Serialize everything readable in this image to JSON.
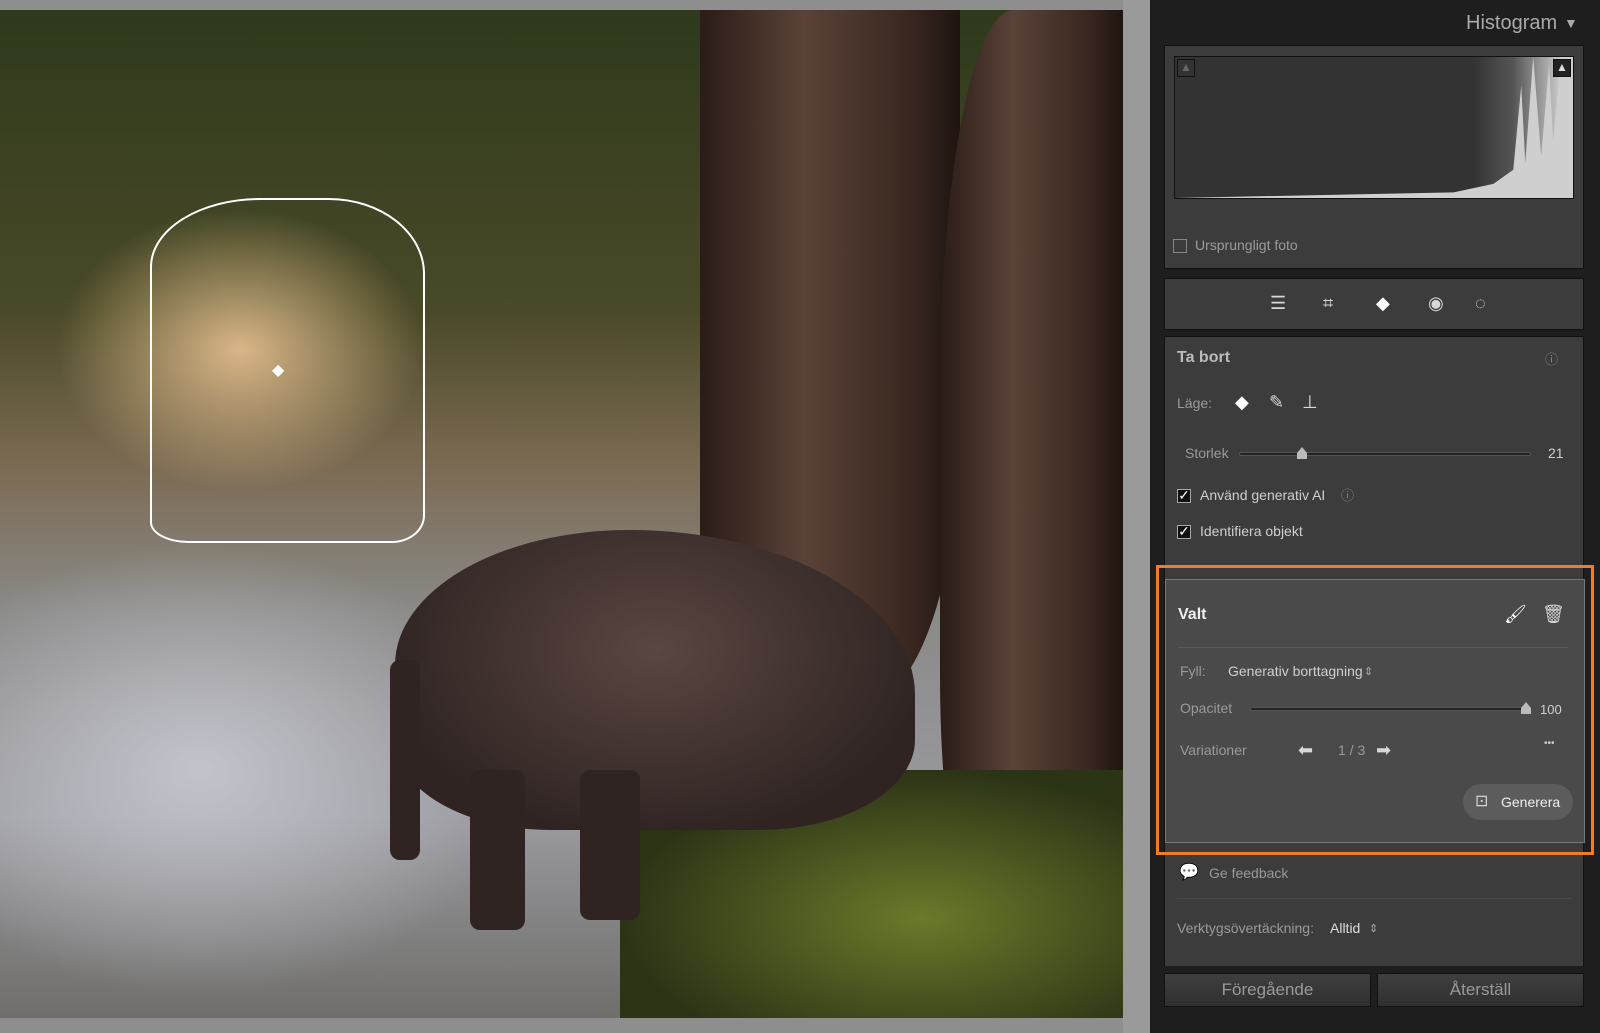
{
  "histogram": {
    "title": "Histogram",
    "original_photo_label": "Ursprungligt foto",
    "original_photo_checked": false
  },
  "toolbar": {
    "tools": [
      "edit-sliders-icon",
      "crop-icon",
      "remove-eraser-icon",
      "red-eye-icon",
      "masking-icon"
    ],
    "active": "remove-eraser-icon"
  },
  "remove": {
    "title": "Ta bort",
    "mode_label": "Läge:",
    "modes": [
      "eraser-icon",
      "heal-icon",
      "clone-stamp-icon"
    ],
    "size_label": "Storlek",
    "size_value": "21",
    "size": 21,
    "use_gen_ai_label": "Använd generativ AI",
    "use_gen_ai_checked": true,
    "detect_objects_label": "Identifiera objekt",
    "detect_objects_checked": true
  },
  "selected": {
    "title": "Valt",
    "fill_label": "Fyll:",
    "fill_value": "Generativ borttagning",
    "opacity_label": "Opacitet",
    "opacity_value": "100",
    "opacity": 100,
    "variations_label": "Variationer",
    "variations_value": "1 / 3",
    "more": "•••",
    "generate_label": "Generera"
  },
  "feedback_label": "Ge feedback",
  "overlay": {
    "label": "Verktygsövertäckning:",
    "value": "Alltid"
  },
  "buttons": {
    "previous": "Föregående",
    "reset": "Återställ"
  },
  "colors": {
    "highlight": "#f47b20",
    "panel": "#3c3c3c"
  }
}
